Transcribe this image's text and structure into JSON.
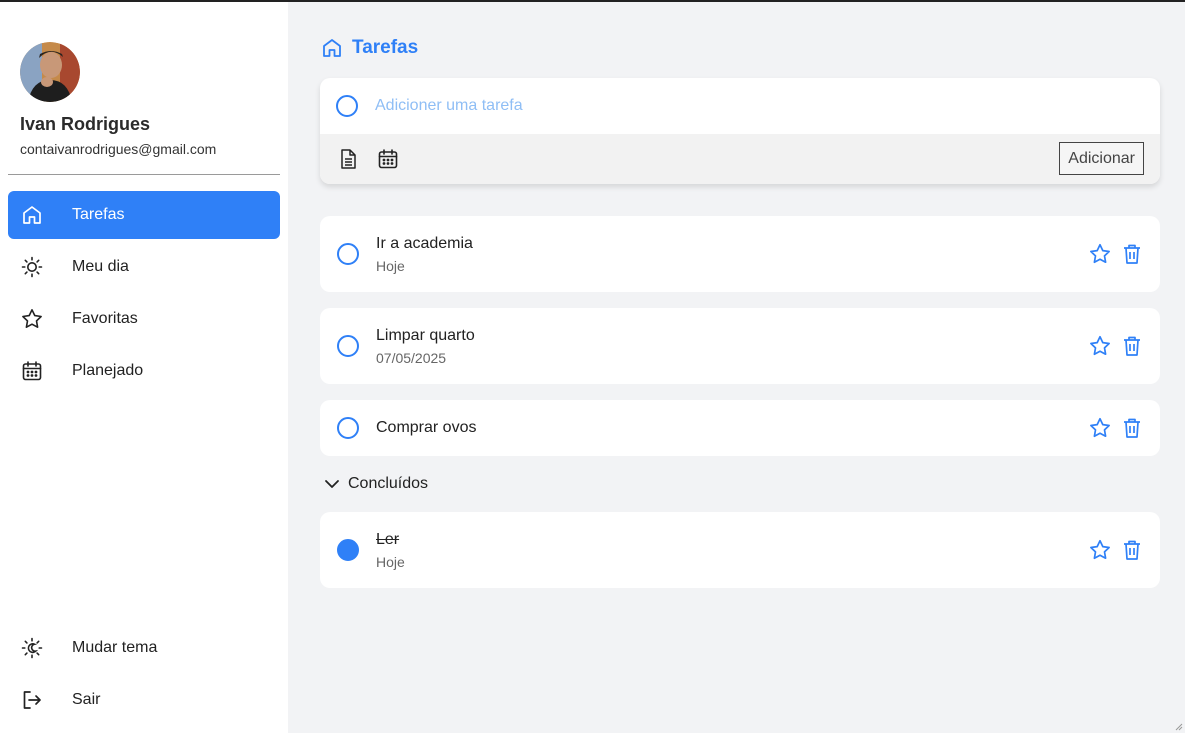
{
  "user": {
    "name": "Ivan Rodrigues",
    "email": "contaivanrodrigues@gmail.com"
  },
  "nav": {
    "items": [
      {
        "label": "Tarefas",
        "icon": "home-icon",
        "active": true
      },
      {
        "label": "Meu dia",
        "icon": "sun-icon",
        "active": false
      },
      {
        "label": "Favoritas",
        "icon": "star-icon",
        "active": false
      },
      {
        "label": "Planejado",
        "icon": "calendar-icon",
        "active": false
      }
    ],
    "bottom": [
      {
        "label": "Mudar tema",
        "icon": "theme-icon"
      },
      {
        "label": "Sair",
        "icon": "logout-icon"
      }
    ]
  },
  "page": {
    "title": "Tarefas"
  },
  "add_task": {
    "placeholder": "Adicioner uma tarefa",
    "button_label": "Adicionar"
  },
  "tasks": [
    {
      "title": "Ir a academia",
      "date": "Hoje"
    },
    {
      "title": "Limpar quarto",
      "date": "07/05/2025"
    },
    {
      "title": "Comprar ovos",
      "date": ""
    }
  ],
  "completed": {
    "header": "Concluídos",
    "tasks": [
      {
        "title": "Ler",
        "date": "Hoje"
      }
    ]
  },
  "colors": {
    "accent": "#2f80f7",
    "background": "#f2f3f5",
    "placeholder": "#8fbef5"
  }
}
